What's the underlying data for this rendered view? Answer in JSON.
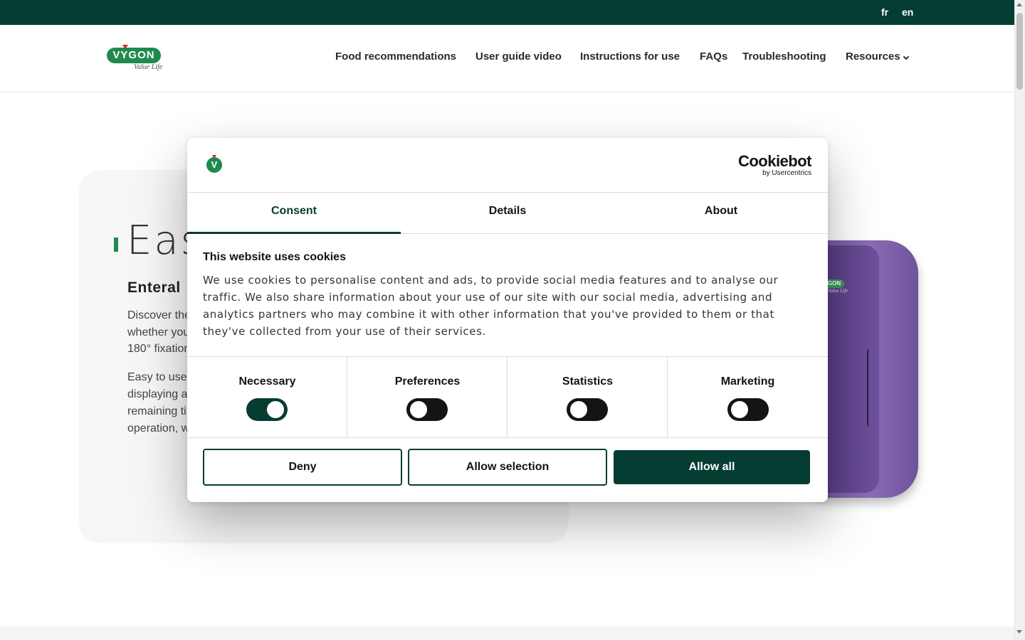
{
  "topbar": {
    "languages": [
      {
        "label": "fr"
      },
      {
        "label": "en"
      }
    ]
  },
  "header": {
    "logo_text": "VYGON",
    "logo_tagline": "Value Life",
    "nav": [
      {
        "label": "Food recommendations"
      },
      {
        "label": "User guide video"
      },
      {
        "label": "Instructions for use"
      },
      {
        "label": "FAQs"
      },
      {
        "label": "Troubleshooting"
      },
      {
        "label": "Resources"
      }
    ]
  },
  "hero": {
    "title": "Eas",
    "subtitle": "Enteral",
    "paragraph1": [
      "Discover the",
      "whether you",
      "180° fixation"
    ],
    "paragraph2": [
      "Easy to use",
      "displaying a",
      "remaining ti",
      "operation, w"
    ]
  },
  "device": {
    "logo_text": "GON",
    "tagline": "Value Life"
  },
  "cookie_dialog": {
    "logo_letter": "V",
    "brand_name": "Cookiebot",
    "brand_by": "by Usercentrics",
    "tabs": [
      {
        "label": "Consent",
        "active": true
      },
      {
        "label": "Details",
        "active": false
      },
      {
        "label": "About",
        "active": false
      }
    ],
    "title": "This website uses cookies",
    "body": "We use cookies to personalise content and ads, to provide social media features and to analyse our traffic. We also share information about your use of our site with our social media, advertising and analytics partners who may combine it with other information that you've provided to them or that they've collected from your use of their services.",
    "categories": [
      {
        "label": "Necessary",
        "enabled": true
      },
      {
        "label": "Preferences",
        "enabled": false
      },
      {
        "label": "Statistics",
        "enabled": false
      },
      {
        "label": "Marketing",
        "enabled": false
      }
    ],
    "buttons": {
      "deny": "Deny",
      "allow_selection": "Allow selection",
      "allow_all": "Allow all"
    }
  },
  "colors": {
    "brand_dark_green": "#063d33",
    "brand_green": "#1f8a4c",
    "logo_red": "#d7262b",
    "device_purple": "#7c5fab"
  }
}
